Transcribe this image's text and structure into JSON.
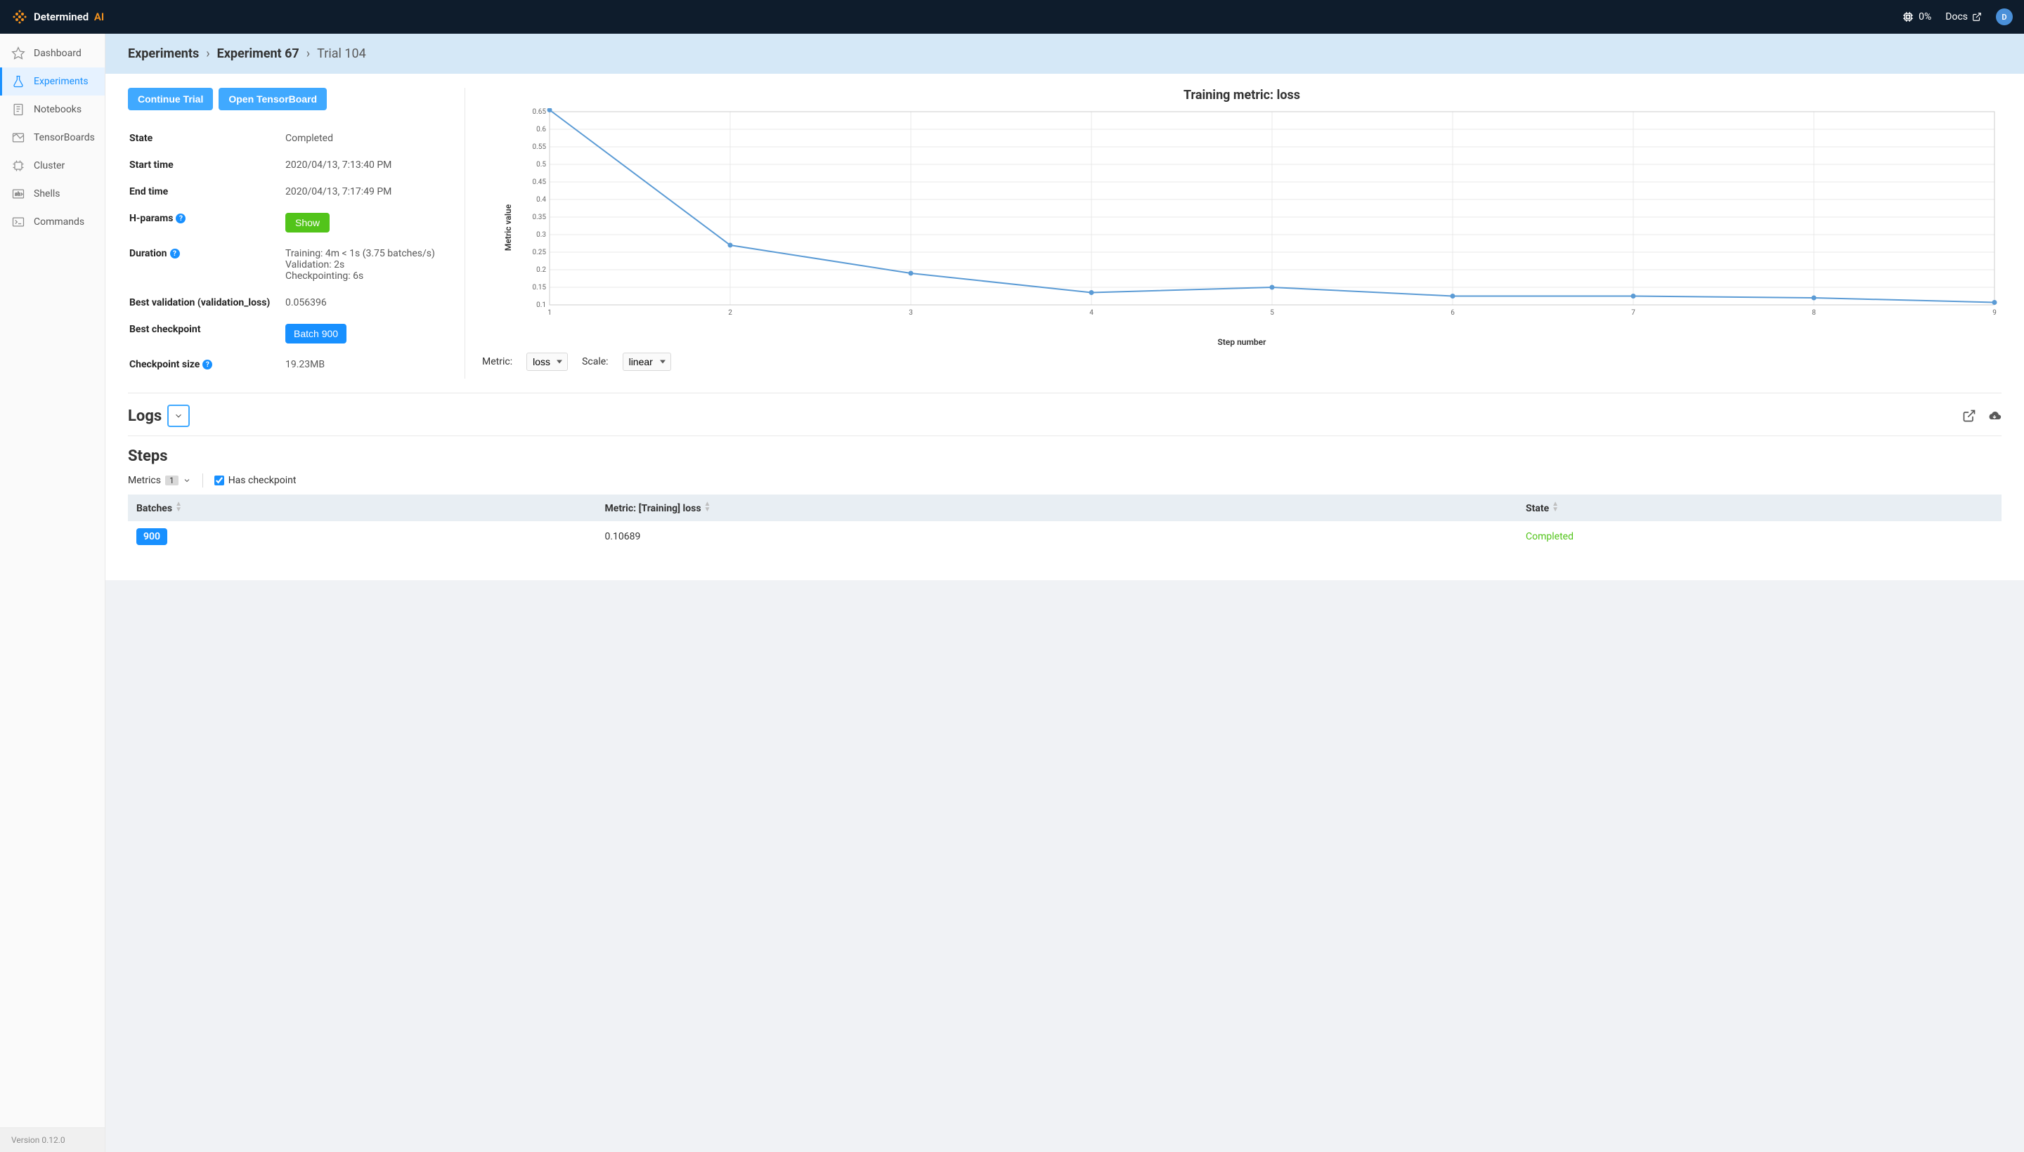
{
  "brand": {
    "name": "Determined",
    "suffix": "AI"
  },
  "topbar": {
    "cpu": "0%",
    "docs": "Docs",
    "avatar_initial": "D"
  },
  "sidebar": {
    "items": [
      {
        "label": "Dashboard"
      },
      {
        "label": "Experiments"
      },
      {
        "label": "Notebooks"
      },
      {
        "label": "TensorBoards"
      },
      {
        "label": "Cluster"
      },
      {
        "label": "Shells"
      },
      {
        "label": "Commands"
      }
    ],
    "version": "Version 0.12.0"
  },
  "breadcrumb": {
    "exp_list": "Experiments",
    "exp": "Experiment 67",
    "trial": "Trial 104"
  },
  "actions": {
    "continue": "Continue Trial",
    "tensorboard": "Open TensorBoard"
  },
  "info": {
    "state_label": "State",
    "state_value": "Completed",
    "start_label": "Start time",
    "start_value": "2020/04/13, 7:13:40 PM",
    "end_label": "End time",
    "end_value": "2020/04/13, 7:17:49 PM",
    "hparams_label": "H-params",
    "hparams_btn": "Show",
    "duration_label": "Duration",
    "duration_training": "Training: 4m < 1s (3.75 batches/s)",
    "duration_validation": "Validation: 2s",
    "duration_checkpoint": "Checkpointing: 6s",
    "best_val_label": "Best validation (validation_loss)",
    "best_val_value": "0.056396",
    "best_ckpt_label": "Best checkpoint",
    "best_ckpt_btn": "Batch 900",
    "ckpt_size_label": "Checkpoint size",
    "ckpt_size_value": "19.23MB"
  },
  "chart_data": {
    "type": "line",
    "title": "Training metric: loss",
    "xlabel": "Step number",
    "ylabel": "Metric value",
    "x": [
      1,
      2,
      3,
      4,
      5,
      6,
      7,
      8,
      9
    ],
    "values": [
      0.655,
      0.27,
      0.19,
      0.135,
      0.15,
      0.125,
      0.125,
      0.12,
      0.107
    ],
    "ylim": [
      0.1,
      0.65
    ],
    "yticks": [
      0.1,
      0.15,
      0.2,
      0.25,
      0.3,
      0.35,
      0.4,
      0.45,
      0.5,
      0.55,
      0.6,
      0.65
    ]
  },
  "chart_controls": {
    "metric_label": "Metric:",
    "metric_value": "loss",
    "scale_label": "Scale:",
    "scale_value": "linear"
  },
  "logs": {
    "title": "Logs"
  },
  "steps": {
    "title": "Steps",
    "metrics_label": "Metrics",
    "metrics_count": "1",
    "has_checkpoint_label": "Has checkpoint",
    "columns": {
      "batches": "Batches",
      "metric": "Metric: [Training] loss",
      "state": "State"
    },
    "rows": [
      {
        "batches": "900",
        "metric": "0.10689",
        "state": "Completed"
      }
    ]
  }
}
